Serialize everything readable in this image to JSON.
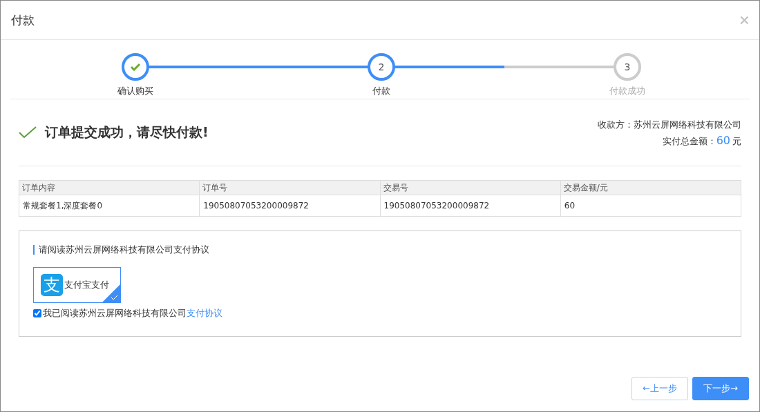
{
  "dialog": {
    "title": "付款",
    "close": "×"
  },
  "steps": {
    "items": [
      {
        "label": "确认购买",
        "kind": "done"
      },
      {
        "number": "2",
        "label": "付款",
        "kind": "current"
      },
      {
        "number": "3",
        "label": "付款成功",
        "kind": "todo",
        "level": 0.5
      }
    ]
  },
  "result": {
    "message": "订单提交成功，请尽快付款!",
    "payee_label": "收款方：",
    "payee": "苏州云屏网络科技有限公司",
    "total_label": "实付总金额：",
    "total": "60",
    "unit": "元"
  },
  "table": {
    "columns": [
      "订单内容",
      "订单号",
      "交易号",
      "交易金额/元"
    ],
    "rows": [
      [
        "常规套餐1,深度套餐0",
        "19050807053200009872",
        "19050807053200009872",
        "60"
      ]
    ]
  },
  "agreement": {
    "heading": "请阅读苏州云屏网络科技有限公司支付协议",
    "methods": [
      {
        "logo": "支",
        "label": "支付宝支付",
        "selected": true
      }
    ],
    "consent": {
      "checked": true,
      "text": "我已阅读苏州云屏网络科技有限公司",
      "link": "支付协议"
    }
  },
  "buttons": [
    {
      "label": "←上一步",
      "kind": "secondary"
    },
    {
      "label": "下一步→",
      "kind": "primary"
    }
  ]
}
